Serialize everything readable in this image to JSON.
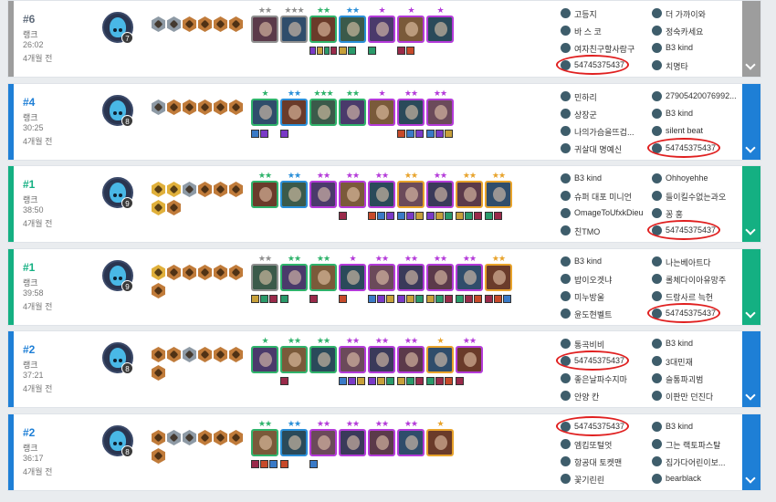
{
  "colors": {
    "gray": "#9d9d9d",
    "blue": "#1e7fd6",
    "green": "#14b082",
    "bronze": "#c07b3a",
    "silver": "#8e9aa5",
    "gold": "#e0b03b",
    "highlight_circle": "#e02020"
  },
  "matches": [
    {
      "placement": "#6",
      "placement_color": "#5f6b7a",
      "stripe": "gray",
      "mode": "랭크",
      "duration": "26:02",
      "ago": "4개월 전",
      "level": "7",
      "traits": [
        "silver",
        "silver",
        "bronze",
        "bronze",
        "bronze",
        "bronze"
      ],
      "units": [
        {
          "stars": "★★",
          "cost": 1,
          "items": 0
        },
        {
          "stars": "★★★",
          "cost": 1,
          "items": 0
        },
        {
          "stars": "★★",
          "cost": 2,
          "items": 4
        },
        {
          "stars": "★★",
          "cost": 3,
          "items": 2
        },
        {
          "stars": "★",
          "cost": 4,
          "items": 1
        },
        {
          "stars": "★",
          "cost": 4,
          "items": 2
        },
        {
          "stars": "★",
          "cost": 4,
          "items": 0
        }
      ],
      "players_left": [
        "고등지",
        "바 스 코",
        "여자친구할사람구",
        "54745375437"
      ],
      "players_right": [
        "더 가까이와",
        "정숙카세요",
        "B3 kind",
        "치명타"
      ],
      "highlight": "left-3"
    },
    {
      "placement": "#4",
      "placement_color": "#1e7fd6",
      "stripe": "blue",
      "mode": "랭크",
      "duration": "30:25",
      "ago": "4개월 전",
      "level": "8",
      "traits": [
        "silver",
        "bronze",
        "bronze",
        "bronze",
        "bronze",
        "bronze"
      ],
      "units": [
        {
          "stars": "★",
          "cost": 2,
          "items": 2
        },
        {
          "stars": "★★",
          "cost": 3,
          "items": 1
        },
        {
          "stars": "★★★",
          "cost": 2,
          "items": 0
        },
        {
          "stars": "★★",
          "cost": 2,
          "items": 0
        },
        {
          "stars": "★",
          "cost": 4,
          "items": 0
        },
        {
          "stars": "★★",
          "cost": 4,
          "items": 3
        },
        {
          "stars": "★★",
          "cost": 4,
          "items": 3
        }
      ],
      "players_left": [
        "민하리",
        "상장군",
        "나의가슴을뜨겁...",
        "귀살대 명예신"
      ],
      "players_right": [
        "27905420076992...",
        "B3 kind",
        "silent beat",
        "54745375437"
      ],
      "highlight": "right-3"
    },
    {
      "placement": "#1",
      "placement_color": "#14b082",
      "stripe": "green",
      "mode": "랭크",
      "duration": "38:50",
      "ago": "4개월 전",
      "level": "9",
      "traits": [
        "gold",
        "gold",
        "silver",
        "bronze",
        "bronze",
        "bronze",
        "gold",
        "bronze"
      ],
      "units": [
        {
          "stars": "★★",
          "cost": 2,
          "items": 0
        },
        {
          "stars": "★★",
          "cost": 3,
          "items": 0
        },
        {
          "stars": "★★",
          "cost": 4,
          "items": 0
        },
        {
          "stars": "★★",
          "cost": 4,
          "items": 1
        },
        {
          "stars": "★★",
          "cost": 4,
          "items": 3
        },
        {
          "stars": "★★",
          "cost": 5,
          "items": 3
        },
        {
          "stars": "★★",
          "cost": 4,
          "items": 3
        },
        {
          "stars": "★★",
          "cost": 5,
          "items": 3
        },
        {
          "stars": "★★",
          "cost": 5,
          "items": 2
        }
      ],
      "players_left": [
        "B3 kind",
        "슈퍼 대포 미니언",
        "OmageToUfxkDieu",
        "친TMO"
      ],
      "players_right": [
        "Ohhoyehhe",
        "들이킬수없는과오",
        "꽁 홍",
        "54745375437"
      ],
      "highlight": "right-3"
    },
    {
      "placement": "#1",
      "placement_color": "#14b082",
      "stripe": "green",
      "mode": "랭크",
      "duration": "39:58",
      "ago": "4개월 전",
      "level": "9",
      "traits": [
        "gold",
        "bronze",
        "bronze",
        "bronze",
        "bronze",
        "bronze",
        "bronze"
      ],
      "units": [
        {
          "stars": "★★",
          "cost": 1,
          "items": 3
        },
        {
          "stars": "★★",
          "cost": 2,
          "items": 1
        },
        {
          "stars": "★★",
          "cost": 2,
          "items": 1
        },
        {
          "stars": "★",
          "cost": 4,
          "items": 1
        },
        {
          "stars": "★★",
          "cost": 4,
          "items": 3
        },
        {
          "stars": "★★",
          "cost": 4,
          "items": 3
        },
        {
          "stars": "★★",
          "cost": 4,
          "items": 3
        },
        {
          "stars": "★★",
          "cost": 4,
          "items": 3
        },
        {
          "stars": "★★",
          "cost": 5,
          "items": 3
        }
      ],
      "players_left": [
        "B3 kind",
        "밥이오겟냐",
        "미누방울",
        "윤도현벨트"
      ],
      "players_right": [
        "나는베아트다",
        "롤체다이아유망주",
        "드랑사르 늑헌",
        "54745375437"
      ],
      "highlight": "right-3"
    },
    {
      "placement": "#2",
      "placement_color": "#1e7fd6",
      "stripe": "blue",
      "mode": "랭크",
      "duration": "37:21",
      "ago": "4개월 전",
      "level": "8",
      "traits": [
        "bronze",
        "bronze",
        "silver",
        "bronze",
        "bronze",
        "bronze",
        "bronze"
      ],
      "units": [
        {
          "stars": "★",
          "cost": 2,
          "items": 0
        },
        {
          "stars": "★★",
          "cost": 2,
          "items": 1
        },
        {
          "stars": "★★",
          "cost": 2,
          "items": 0
        },
        {
          "stars": "★★",
          "cost": 4,
          "items": 3
        },
        {
          "stars": "★★",
          "cost": 4,
          "items": 3
        },
        {
          "stars": "★★",
          "cost": 4,
          "items": 3
        },
        {
          "stars": "★",
          "cost": 5,
          "items": 3
        },
        {
          "stars": "★★",
          "cost": 4,
          "items": 1
        }
      ],
      "players_left": [
        "통곡비비",
        "54745375437",
        "좋은날파수지마",
        "안양 칸"
      ],
      "players_right": [
        "B3 kind",
        "3대민재",
        "슬통파괴범",
        "이판만 던진다"
      ],
      "highlight": "left-1"
    },
    {
      "placement": "#2",
      "placement_color": "#1e7fd6",
      "stripe": "blue",
      "mode": "랭크",
      "duration": "36:17",
      "ago": "4개월 전",
      "level": "8",
      "traits": [
        "bronze",
        "silver",
        "silver",
        "bronze",
        "bronze",
        "bronze",
        "bronze"
      ],
      "units": [
        {
          "stars": "★★",
          "cost": 2,
          "items": 3
        },
        {
          "stars": "★★",
          "cost": 3,
          "items": 1
        },
        {
          "stars": "★★",
          "cost": 4,
          "items": 1
        },
        {
          "stars": "★★",
          "cost": 4,
          "items": 0
        },
        {
          "stars": "★★",
          "cost": 4,
          "items": 0
        },
        {
          "stars": "★★",
          "cost": 4,
          "items": 0
        },
        {
          "stars": "★",
          "cost": 5,
          "items": 0
        }
      ],
      "players_left": [
        "54745375437",
        "엠킴또털엇",
        "항공대 토켓맨",
        "꽃기린린"
      ],
      "players_right": [
        "B3 kind",
        "그는 랙토파스탈",
        "집가다어린이보...",
        "bearblack"
      ],
      "highlight": "left-0"
    }
  ]
}
